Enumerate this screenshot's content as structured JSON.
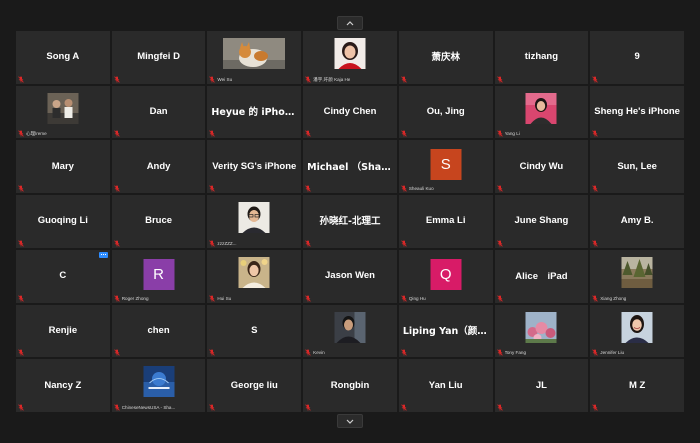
{
  "colors": {
    "background": "#1a1a1a",
    "tile": "#2a2a2a",
    "name_text": "#ffffff",
    "mute_icon": "#e02828",
    "more_button": "#2d8cff"
  },
  "navigation": {
    "up_icon": "chevron-up-icon",
    "down_icon": "chevron-down-icon"
  },
  "tiles": [
    {
      "type": "name",
      "name": "Song A",
      "muted": true
    },
    {
      "type": "name",
      "name": "Mingfei D",
      "muted": true
    },
    {
      "type": "photo",
      "photo": "cat",
      "label": "Wei Su",
      "muted": true
    },
    {
      "type": "photo",
      "photo": "woman-red",
      "label": "潘宇,吁颜 Kaja He",
      "muted": true
    },
    {
      "type": "name",
      "name": "萧庆林",
      "muted": true,
      "cjk": true
    },
    {
      "type": "name",
      "name": "tizhang",
      "muted": true
    },
    {
      "type": "name",
      "name": "9",
      "muted": true
    },
    {
      "type": "photo",
      "photo": "group-people",
      "label": "心理lreme",
      "muted": true
    },
    {
      "type": "name",
      "name": "Dan",
      "muted": true
    },
    {
      "type": "name",
      "name": "Heyue 的 iPhone",
      "muted": true,
      "cjk": true
    },
    {
      "type": "name",
      "name": "Cindy Chen",
      "muted": true
    },
    {
      "type": "name",
      "name": "Ou, Jing",
      "muted": true
    },
    {
      "type": "photo",
      "photo": "woman-pink",
      "label": "Yang Li",
      "muted": true
    },
    {
      "type": "name",
      "name": "Sheng He's iPhone",
      "muted": true
    },
    {
      "type": "name",
      "name": "Mary",
      "muted": true
    },
    {
      "type": "name",
      "name": "Andy",
      "muted": true
    },
    {
      "type": "name",
      "name": "Verity SG's iPhone",
      "muted": true
    },
    {
      "type": "name",
      "name": "Michael （Shan…",
      "muted": true,
      "cjk": true
    },
    {
      "type": "letter",
      "letter": "S",
      "color": "#c7451e",
      "label": "Sheauli Kuo",
      "muted": true
    },
    {
      "type": "name",
      "name": "Cindy Wu",
      "muted": true
    },
    {
      "type": "name",
      "name": "Sun, Lee",
      "muted": true
    },
    {
      "type": "name",
      "name": "Guoqing Li",
      "muted": true
    },
    {
      "type": "name",
      "name": "Bruce",
      "muted": true
    },
    {
      "type": "photo",
      "photo": "man-glasses",
      "label": "zzzZZZ...",
      "muted": true
    },
    {
      "type": "name",
      "name": "孙晓红-北理工",
      "muted": true,
      "cjk": true
    },
    {
      "type": "name",
      "name": "Emma Li",
      "muted": true
    },
    {
      "type": "name",
      "name": "June Shang",
      "muted": true
    },
    {
      "type": "name",
      "name": "Amy B.",
      "muted": true
    },
    {
      "type": "name",
      "name": "C",
      "muted": true,
      "more": true
    },
    {
      "type": "letter",
      "letter": "R",
      "color": "#8a3ea8",
      "label": "Roger Zhong",
      "muted": true
    },
    {
      "type": "photo",
      "photo": "woman-flowers",
      "label": "Hui Su",
      "muted": true
    },
    {
      "type": "name",
      "name": "Jason Wen",
      "muted": true
    },
    {
      "type": "letter",
      "letter": "Q",
      "color": "#d81b67",
      "label": "Qing Hu",
      "muted": true
    },
    {
      "type": "name",
      "name": "Alice　iPad",
      "muted": true
    },
    {
      "type": "photo",
      "photo": "trees",
      "label": "Xiang Zhong",
      "muted": true
    },
    {
      "type": "name",
      "name": "Renjie",
      "muted": true
    },
    {
      "type": "name",
      "name": "chen",
      "muted": true
    },
    {
      "type": "name",
      "name": "S",
      "muted": true
    },
    {
      "type": "photo",
      "photo": "man-dark",
      "label": "Kevin",
      "muted": true
    },
    {
      "type": "name",
      "name": "Liping Yan（颜利…",
      "muted": true,
      "cjk": true
    },
    {
      "type": "photo",
      "photo": "flowers",
      "label": "Tony Fang",
      "muted": true
    },
    {
      "type": "photo",
      "photo": "woman-smile",
      "label": "Jennifer Liu",
      "muted": true
    },
    {
      "type": "name",
      "name": "Nancy Z",
      "muted": true
    },
    {
      "type": "photo",
      "photo": "blue-banner",
      "label": "ChineseNewsUSA - Sha...",
      "muted": true
    },
    {
      "type": "name",
      "name": "George liu",
      "muted": true
    },
    {
      "type": "name",
      "name": "Rongbin",
      "muted": true
    },
    {
      "type": "name",
      "name": "Yan Liu",
      "muted": true
    },
    {
      "type": "name",
      "name": "JL",
      "muted": true
    },
    {
      "type": "name",
      "name": "M Z",
      "muted": true
    }
  ]
}
